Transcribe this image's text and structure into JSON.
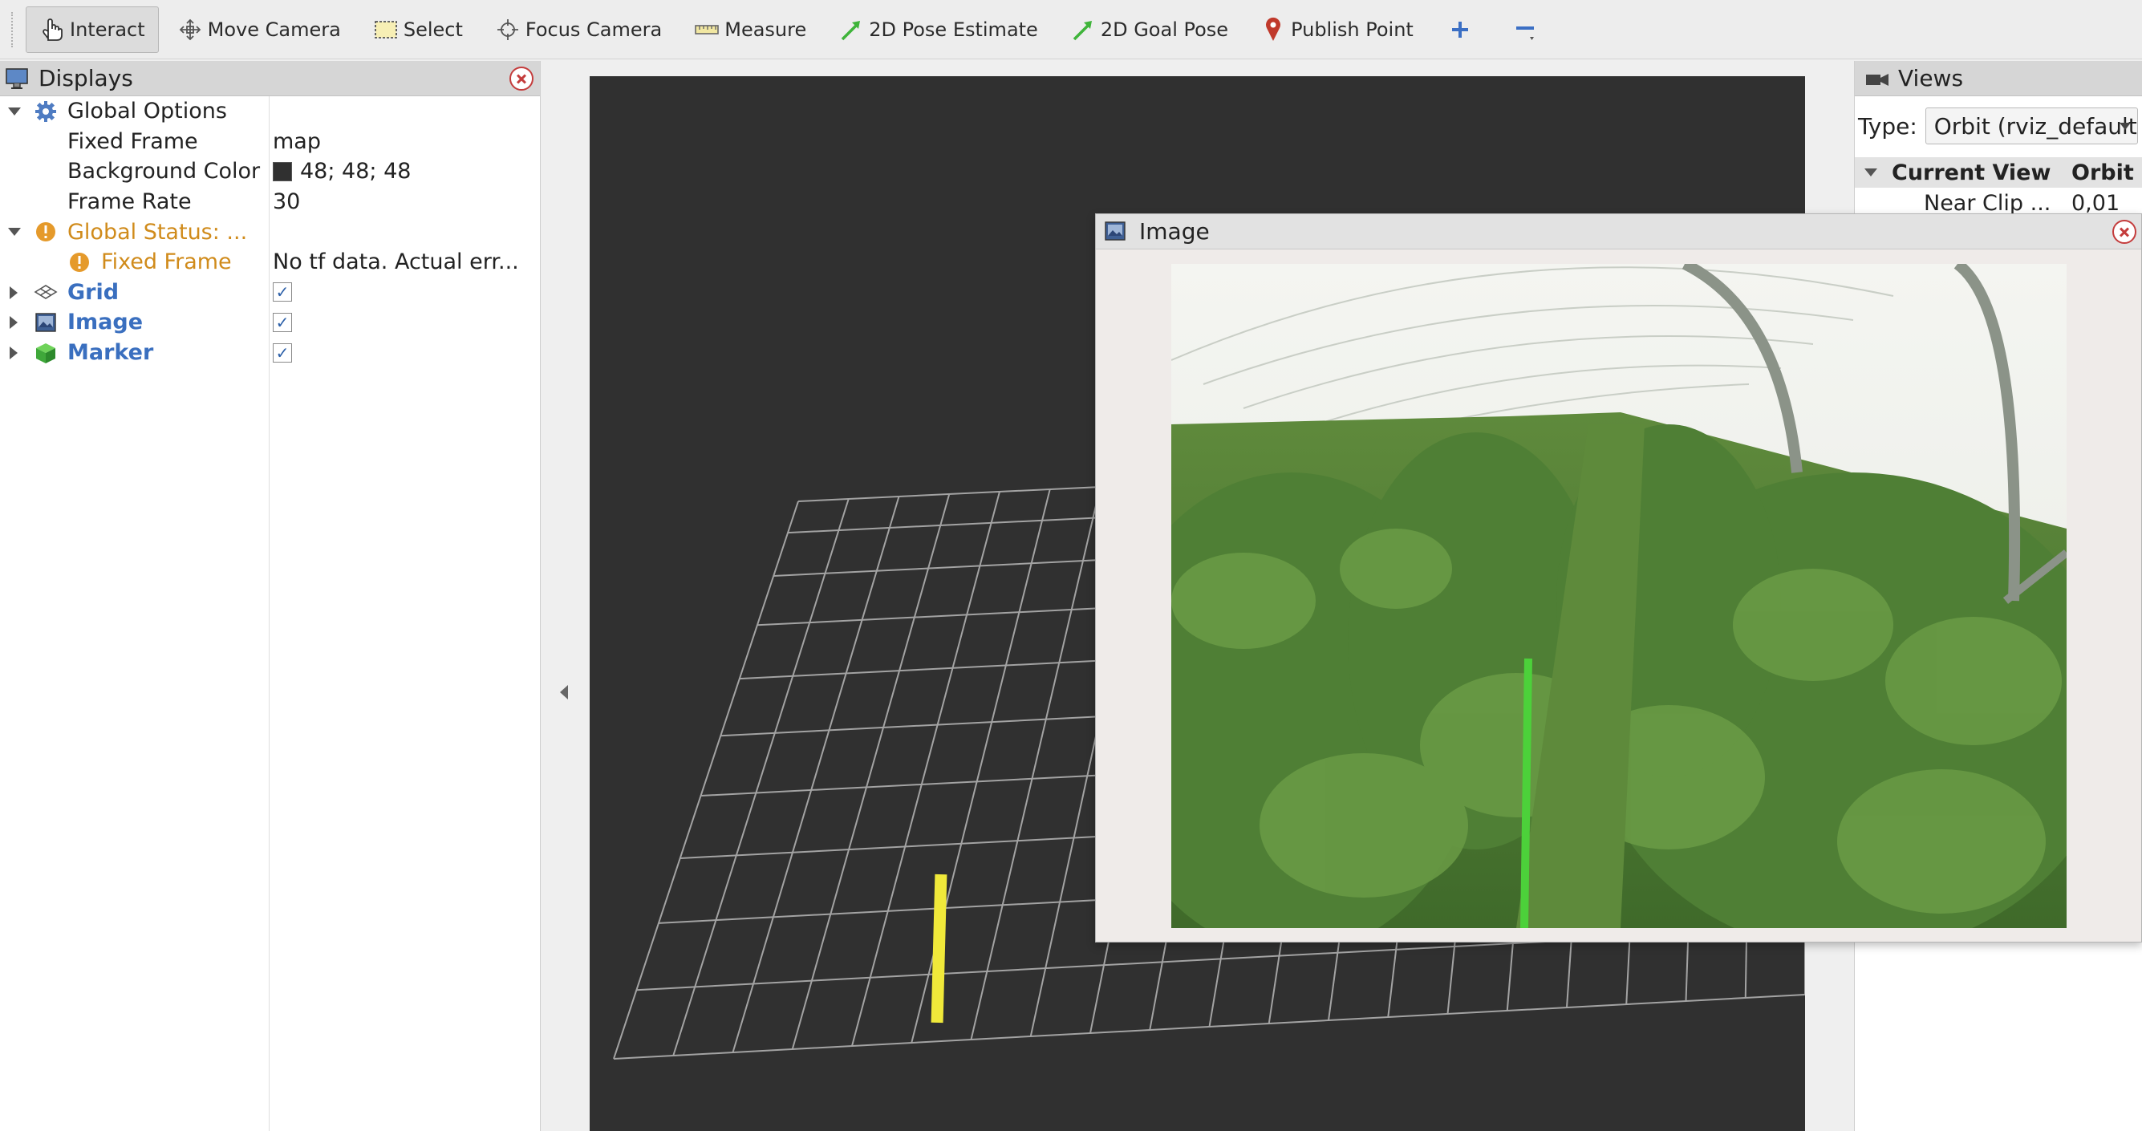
{
  "toolbar": {
    "tools": [
      {
        "id": "interact",
        "label": "Interact",
        "icon": "hand-pointer-icon"
      },
      {
        "id": "move-camera",
        "label": "Move Camera",
        "icon": "move-camera-icon"
      },
      {
        "id": "select",
        "label": "Select",
        "icon": "select-rectangle-icon"
      },
      {
        "id": "focus-camera",
        "label": "Focus Camera",
        "icon": "focus-crosshair-icon"
      },
      {
        "id": "measure",
        "label": "Measure",
        "icon": "ruler-icon"
      },
      {
        "id": "pose-estimate",
        "label": "2D Pose Estimate",
        "icon": "green-arrow-icon"
      },
      {
        "id": "goal-pose",
        "label": "2D Goal Pose",
        "icon": "green-arrow-icon"
      },
      {
        "id": "publish-point",
        "label": "Publish Point",
        "icon": "map-pin-icon"
      }
    ],
    "active_tool": "interact",
    "add_icon": "plus-icon",
    "remove_icon": "minus-icon"
  },
  "displays": {
    "title": "Displays",
    "global_options": {
      "label": "Global Options",
      "fixed_frame_label": "Fixed Frame",
      "fixed_frame_value": "map",
      "background_color_label": "Background Color",
      "background_color_value": "48; 48; 48",
      "background_color_hex": "#303030",
      "frame_rate_label": "Frame Rate",
      "frame_rate_value": "30"
    },
    "global_status": {
      "label": "Global Status: ...",
      "fixed_frame_label": "Fixed Frame",
      "fixed_frame_value": "No tf data.  Actual err..."
    },
    "items": [
      {
        "label": "Grid",
        "icon": "grid-icon",
        "enabled": true
      },
      {
        "label": "Image",
        "icon": "image-icon",
        "enabled": true
      },
      {
        "label": "Marker",
        "icon": "marker-cube-icon",
        "enabled": true
      }
    ],
    "warn_color": "#d08b1b",
    "item_color": "#3a6fbf"
  },
  "viewport": {
    "background_color": "#303030",
    "grid_color": "#a0a0a0",
    "marker_color": "#f0e93a"
  },
  "views": {
    "title": "Views",
    "type_label": "Type:",
    "type_value": "Orbit (rviz_default",
    "header_col1": "Current View",
    "header_col2": "Orbit (",
    "rows": [
      {
        "label": "Near Clip ...",
        "value": "0,01"
      }
    ]
  },
  "image_window": {
    "title": "Image",
    "line_color": "#4cd13a"
  }
}
